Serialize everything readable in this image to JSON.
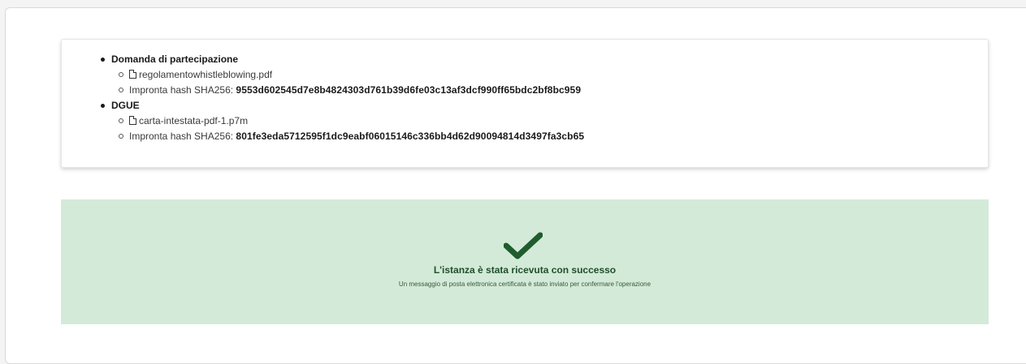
{
  "documents": [
    {
      "title": "Domanda di partecipazione",
      "file_name": "regolamentowhistleblowing.pdf",
      "hash_label": "Impronta hash SHA256:",
      "hash_value": "9553d602545d7e8b4824303d761b39d6fe03c13af3dcf990ff65bdc2bf8bc959"
    },
    {
      "title": "DGUE",
      "file_name": "carta-intestata-pdf-1.p7m",
      "hash_label": "Impronta hash SHA256:",
      "hash_value": "801fe3eda5712595f1dc9eabf06015146c336bb4d62d90094814d3497fa3cb65"
    }
  ],
  "success": {
    "icon": "checkmark-icon",
    "color": "#1f5c2e",
    "background": "#d4ead8",
    "title": "L'istanza è stata ricevuta con successo",
    "message": "Un messaggio di posta elettronica certificata è stato inviato per confermare l'operazione"
  }
}
